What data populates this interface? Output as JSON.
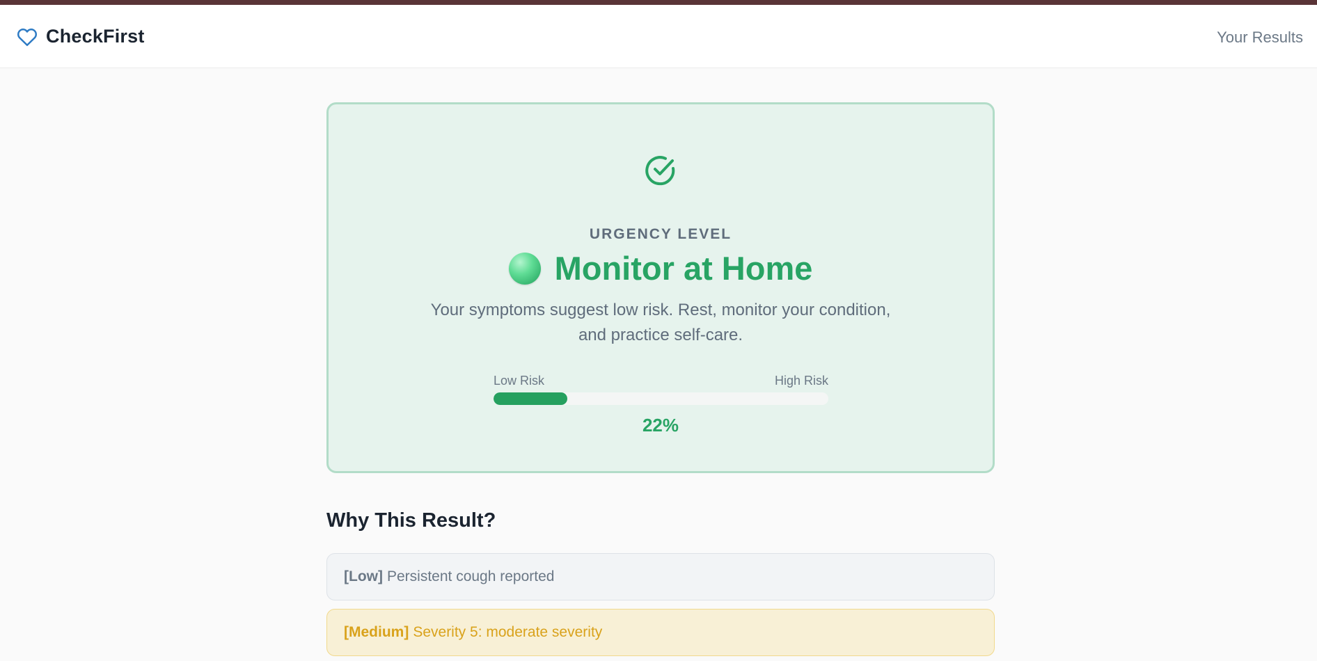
{
  "header": {
    "brand": "CheckFirst",
    "nav_link": "Your Results"
  },
  "result": {
    "urgency_label": "URGENCY LEVEL",
    "headline": "Monitor at Home",
    "summary": "Your symptoms suggest low risk. Rest, monitor your condition, and practice self-care.",
    "risk_low_label": "Low Risk",
    "risk_high_label": "High Risk",
    "risk_value": 0.22,
    "risk_percent": "22%",
    "accent_color": "#28a464"
  },
  "why": {
    "title": "Why This Result?",
    "reasons": [
      {
        "level": "[Low]",
        "text": "Persistent cough reported"
      },
      {
        "level": "[Medium]",
        "text": "Severity 5: moderate severity"
      }
    ]
  },
  "icons": {
    "brand": "heart-icon",
    "result": "check-circle-icon",
    "status": "green-status-orb"
  }
}
